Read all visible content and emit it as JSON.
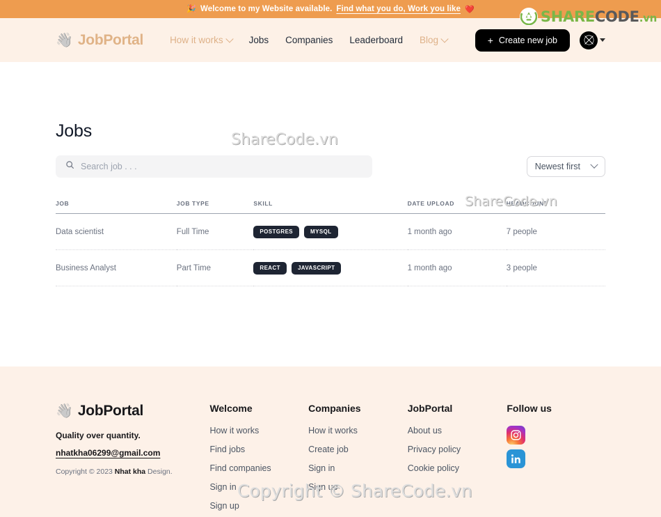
{
  "announcement": {
    "emoji": "🎉",
    "text_plain": "Welcome to my Website available.",
    "text_link": "Find what you do, Work you like",
    "heart": "❤️"
  },
  "sharecode_logo": {
    "share": "SHARE",
    "code": "CODE",
    "vn": ".vn"
  },
  "header": {
    "brand": {
      "emoji": "👋",
      "name": "JobPortal"
    },
    "nav": [
      {
        "label": "How it works",
        "muted": true,
        "has_chevron": true
      },
      {
        "label": "Jobs",
        "muted": false,
        "has_chevron": false
      },
      {
        "label": "Companies",
        "muted": false,
        "has_chevron": false
      },
      {
        "label": "Leaderboard",
        "muted": false,
        "has_chevron": false
      },
      {
        "label": "Blog",
        "muted": true,
        "has_chevron": true
      }
    ],
    "create_button": {
      "plus": "+",
      "label": "Create new job"
    },
    "avatar_glyph": "𝕏"
  },
  "main": {
    "title": "Jobs",
    "search": {
      "value": "",
      "placeholder": "Search job . . ."
    },
    "sort": {
      "selected": "Newest first"
    },
    "table": {
      "columns": [
        "JOB",
        "JOB TYPE",
        "SKILL",
        "DATE UPLOAD",
        "HEADCOUNT"
      ],
      "rows": [
        {
          "job": "Data scientist",
          "job_type": "Full Time",
          "skills": [
            "POSTGRES",
            "MYSQL"
          ],
          "date_upload": "1 month ago",
          "headcount": "7 people"
        },
        {
          "job": "Business Analyst",
          "job_type": "Part Time",
          "skills": [
            "REACT",
            "JAVASCRIPT"
          ],
          "date_upload": "1 month ago",
          "headcount": "3 people"
        }
      ]
    }
  },
  "footer": {
    "brand": {
      "emoji": "👋",
      "name": "JobPortal"
    },
    "tagline": "Quality over quantity.",
    "email": "nhatkha06299@gmail.com",
    "copyright_pre": "Copyright © 2023 ",
    "copyright_name": "Nhat kha",
    "copyright_post": " Design.",
    "columns": [
      {
        "heading": "Welcome",
        "links": [
          "How it works",
          "Find jobs",
          "Find companies",
          "Sign in",
          "Sign up"
        ]
      },
      {
        "heading": "Companies",
        "links": [
          "How it works",
          "Create job",
          "Sign in",
          "Sign up"
        ]
      },
      {
        "heading": "JobPortal",
        "links": [
          "About us",
          "Privacy policy",
          "Cookie policy"
        ]
      }
    ],
    "follow": {
      "heading": "Follow us",
      "networks": [
        "instagram",
        "linkedin"
      ]
    }
  },
  "watermarks": {
    "middle": "ShareCode.vn",
    "table": "ShareCode.vn",
    "bottom": "Copyright © ShareCode.vn"
  }
}
